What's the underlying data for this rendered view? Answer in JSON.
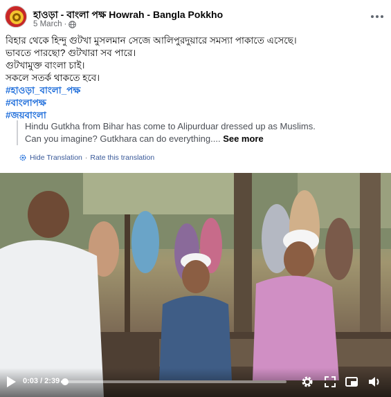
{
  "post": {
    "page_name": "হাওড়া - বাংলা পক্ষ Howrah - Bangla Pokkho",
    "date": "5 March",
    "separator": "·",
    "text_lines": [
      "বিহার থেকে হিন্দু গুটখা মুসলমান সেজে আলিপুরদুয়ারে সমস্যা পাকাতে এসেছে।",
      "ভাবতে পারছো? গুটখারা সব পারে।",
      "গুটখামুক্ত বাংলা চাই।",
      "সকলে সতর্ক থাকতে হবে।"
    ],
    "hashtags": [
      "#হাওড়া_বাংলা_পক্ষ",
      "#বাংলাপক্ষ",
      "#জয়বাংলা"
    ]
  },
  "translation": {
    "line1": "Hindu Gutkha from Bihar has come to Alipurduar dressed up as Muslims.",
    "line2": "Can you imagine? Gutkhara can do everything....",
    "see_more": "See more",
    "hide_label": "Hide Translation",
    "dot": "·",
    "rate_label": "Rate this translation"
  },
  "video": {
    "current_time": "0:03",
    "duration": "2:39",
    "time_display": "0:03 / 2:39",
    "progress_fraction": 0.019
  },
  "icons": {
    "globe": "globe-icon",
    "more": "more-options-icon",
    "translate": "translate-gear-icon",
    "play": "play-icon",
    "settings": "settings-gear-icon",
    "fullscreen": "fullscreen-icon",
    "pip": "picture-in-picture-icon",
    "volume": "volume-icon"
  },
  "colors": {
    "hashtag": "#216fdb",
    "muted_text": "#65676b",
    "link": "#385898"
  }
}
